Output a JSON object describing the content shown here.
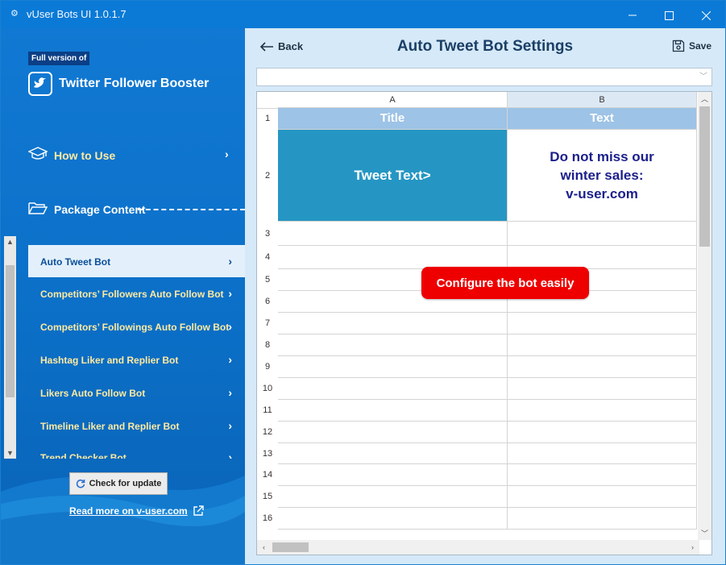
{
  "window": {
    "title": "vUser Bots UI 1.0.1.7"
  },
  "sidebar": {
    "badge": "Full version of",
    "app_name": "Twitter Follower Booster",
    "how_to_use": "How to Use",
    "package_content": "Package Content",
    "bots": [
      {
        "label": "Auto Tweet Bot",
        "active": true
      },
      {
        "label": "Competitors’ Followers Auto Follow Bot"
      },
      {
        "label": "Competitors’ Followings Auto Follow Bot"
      },
      {
        "label": "Hashtag Liker and Replier Bot"
      },
      {
        "label": "Likers Auto Follow Bot"
      },
      {
        "label": "Timeline Liker and Replier Bot"
      },
      {
        "label": "Trend Checker Bot"
      }
    ],
    "check_update": "Check for update",
    "read_more": "Read more on v-user.com"
  },
  "main": {
    "back_label": "Back",
    "page_title": "Auto Tweet Bot Settings",
    "save_label": "Save",
    "combo_value": "",
    "sheet": {
      "columns": [
        "A",
        "B"
      ],
      "rows": [
        "1",
        "2",
        "3",
        "4",
        "5",
        "6",
        "7",
        "8",
        "9",
        "10",
        "11",
        "12",
        "13",
        "14",
        "15",
        "16"
      ],
      "header_row": [
        "Title",
        "Text"
      ],
      "row2_a": "Tweet Text>",
      "row2_b_lines": [
        "Do not miss our",
        "winter sales:",
        "v-user.com"
      ]
    },
    "callout": "Configure the bot easily"
  },
  "colors": {
    "sidebar": "#0b6fc7",
    "accent_yellow": "#ffeaa0",
    "header_cell": "#9dc3e6",
    "tweet_cell": "#2596c3",
    "callout": "#ee0000"
  }
}
